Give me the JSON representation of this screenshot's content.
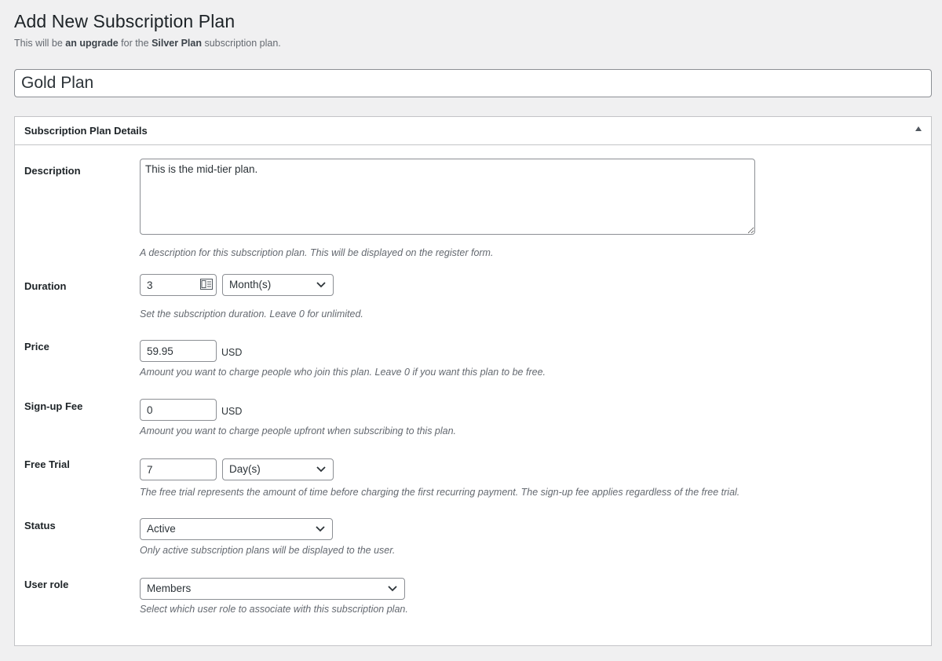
{
  "header": {
    "title": "Add New Subscription Plan",
    "subtitle_prefix": "This will be ",
    "subtitle_bold1": "an upgrade",
    "subtitle_mid": " for the ",
    "subtitle_bold2": "Silver Plan",
    "subtitle_suffix": " subscription plan."
  },
  "plan_name": {
    "value": "Gold Plan"
  },
  "panel": {
    "title": "Subscription Plan Details",
    "toggle_icon": "triangle-up-icon"
  },
  "fields": {
    "description": {
      "label": "Description",
      "value": "This is the mid-tier plan.",
      "help": "A description for this subscription plan. This will be displayed on the register form."
    },
    "duration": {
      "label": "Duration",
      "value": "3",
      "unit_selected": "Month(s)",
      "help": "Set the subscription duration. Leave 0 for unlimited."
    },
    "price": {
      "label": "Price",
      "value": "59.95",
      "currency": "USD",
      "help": "Amount you want to charge people who join this plan. Leave 0 if you want this plan to be free."
    },
    "signup_fee": {
      "label": "Sign-up Fee",
      "value": "0",
      "currency": "USD",
      "help": "Amount you want to charge people upfront when subscribing to this plan."
    },
    "free_trial": {
      "label": "Free Trial",
      "value": "7",
      "unit_selected": "Day(s)",
      "help": "The free trial represents the amount of time before charging the first recurring payment. The sign-up fee applies regardless of the free trial."
    },
    "status": {
      "label": "Status",
      "selected": "Active",
      "help": "Only active subscription plans will be displayed to the user."
    },
    "user_role": {
      "label": "User role",
      "selected": "Members",
      "help": "Select which user role to associate with this subscription plan."
    }
  },
  "colors": {
    "background": "#f0f0f1",
    "panel_border": "#c3c4c7",
    "input_border": "#8c8f94",
    "help_text": "#646970"
  }
}
